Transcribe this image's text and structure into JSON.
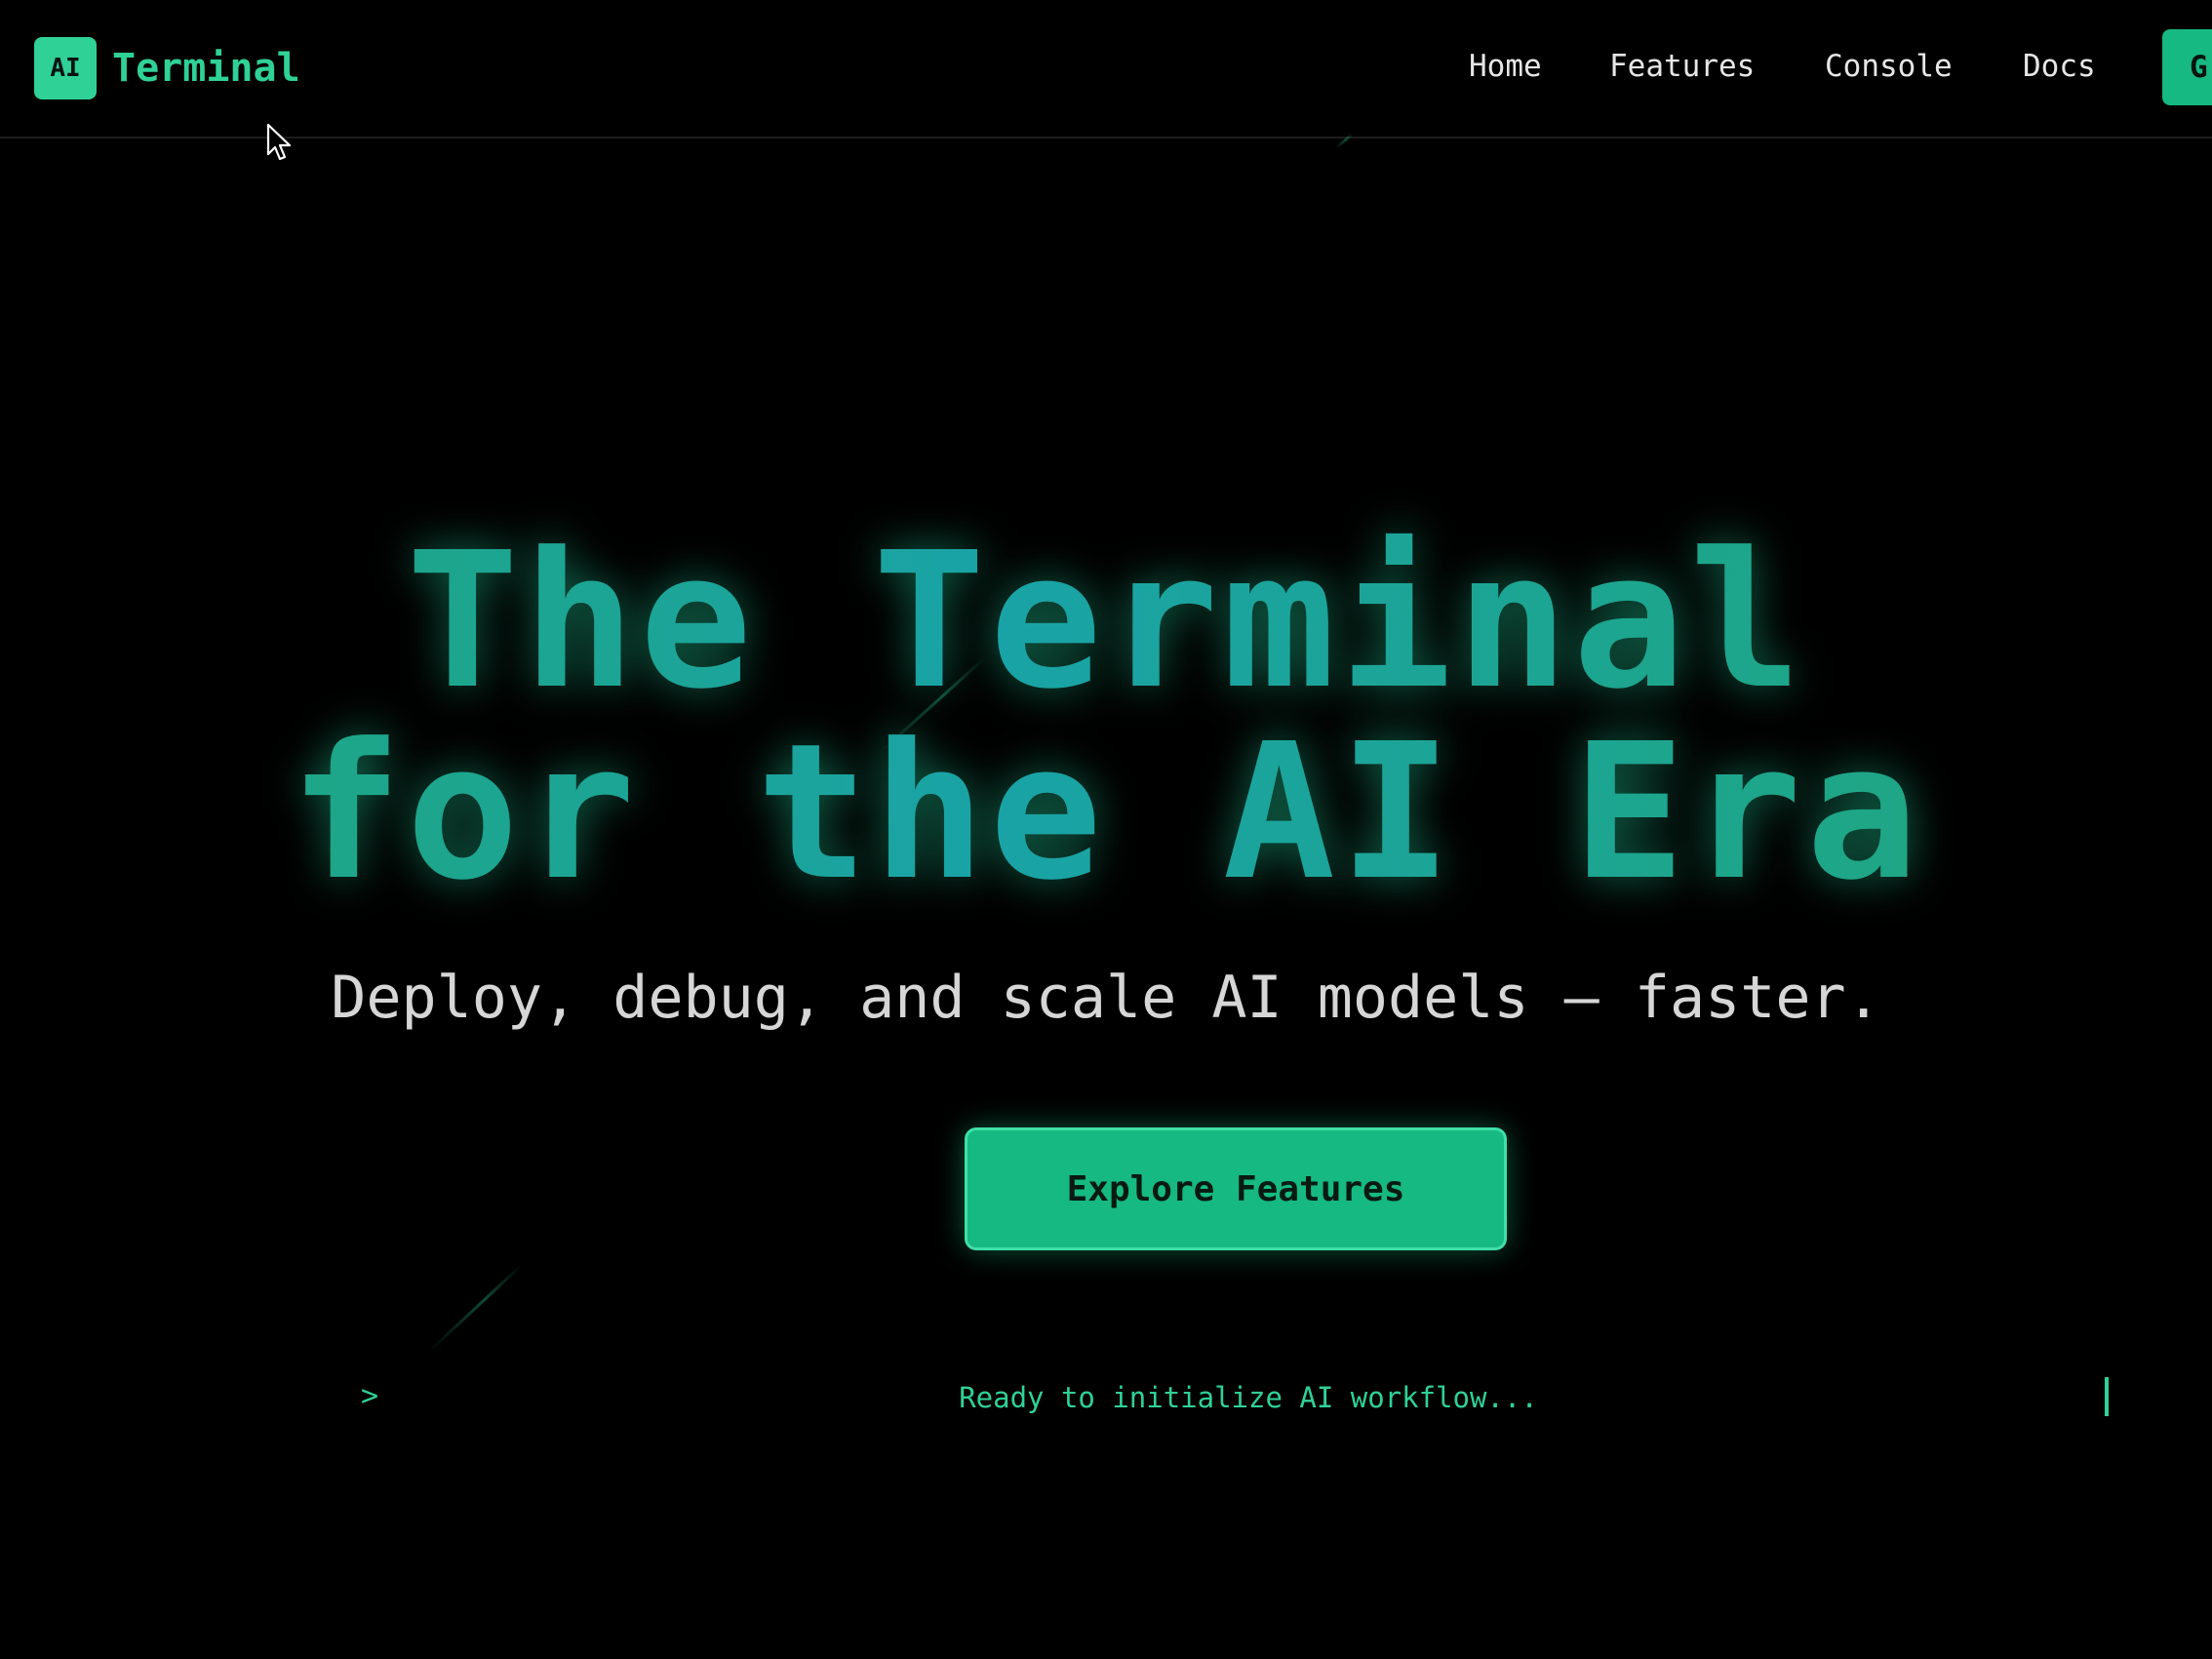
{
  "brand": {
    "badge": "AI",
    "name": "Terminal"
  },
  "nav": {
    "items": [
      {
        "label": "Home"
      },
      {
        "label": "Features"
      },
      {
        "label": "Console"
      },
      {
        "label": "Docs"
      }
    ],
    "cta_label": "G"
  },
  "hero": {
    "title_line1": "The Terminal",
    "title_line2": "for the AI Era",
    "subtitle": "Deploy, debug, and scale AI models — faster.",
    "cta_label": "Explore Features"
  },
  "prompt": {
    "symbol": ">",
    "placeholder": "Ready to initialize AI workflow..."
  },
  "colors": {
    "accent": "#2fd197",
    "button": "#16b981",
    "background": "#000000",
    "text": "#e6e6e6"
  },
  "icons": {
    "cursor": "mouse-pointer-icon"
  }
}
